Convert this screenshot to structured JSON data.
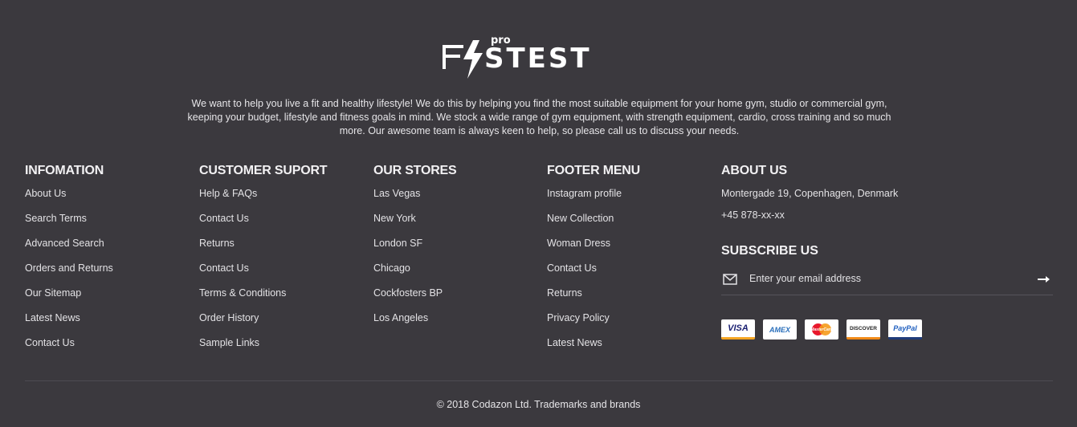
{
  "brand": {
    "logo_text": "FASTEST",
    "logo_superscript": "pro"
  },
  "about_text": "We want to help you live a fit and healthy lifestyle! We do this by helping you find the most suitable equipment for your home gym, studio or commercial gym, keeping your budget, lifestyle and fitness goals in mind. We stock a wide range of gym equipment, with strength equipment, cardio, cross training and so much more. Our awesome team is always keen to help, so please call us to discuss your needs.",
  "columns": [
    {
      "title": "INFOMATION",
      "items": [
        "About Us",
        "Search Terms",
        "Advanced Search",
        "Orders and Returns",
        "Our Sitemap",
        "Latest News",
        "Contact Us"
      ]
    },
    {
      "title": "CUSTOMER SUPORT",
      "items": [
        "Help & FAQs",
        "Contact Us",
        "Returns",
        "Contact Us",
        "Terms & Conditions",
        "Order History",
        "Sample Links"
      ]
    },
    {
      "title": "OUR STORES",
      "items": [
        "Las Vegas",
        "New York",
        "London SF",
        "Chicago",
        "Cockfosters BP",
        "Los Angeles"
      ]
    },
    {
      "title": "FOOTER MENU",
      "items": [
        "Instagram profile",
        "New Collection",
        "Woman Dress",
        "Contact Us",
        "Returns",
        "Privacy Policy",
        "Latest News"
      ]
    }
  ],
  "about_us": {
    "title": "ABOUT US",
    "address": "Montergade 19, Copenhagen, Denmark",
    "phone": "+45 878-xx-xx"
  },
  "subscribe": {
    "title": "SUBSCRIBE US",
    "placeholder": "Enter your email address"
  },
  "payment_cards": [
    "VISA",
    "AMEX",
    "MasterCard",
    "DISCOVER",
    "PayPal"
  ],
  "copyright": "© 2018 Codazon Ltd. Trademarks and brands",
  "colors": {
    "background": "#3b393e",
    "text": "#e9e8ea",
    "divider": "#4d4b52"
  }
}
